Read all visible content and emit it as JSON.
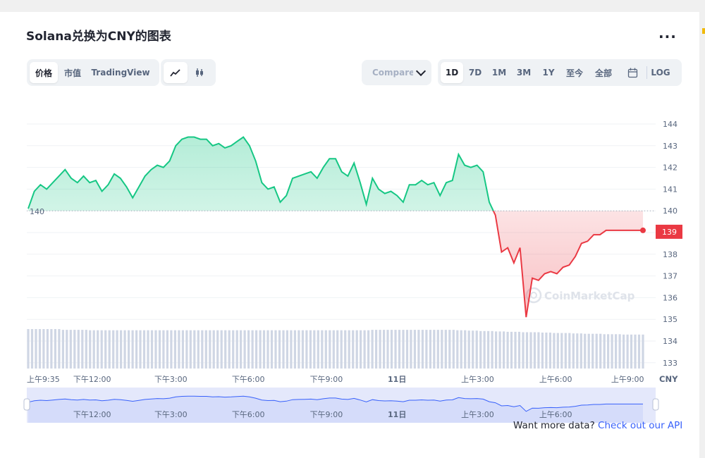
{
  "header": {
    "title": "Solana兑换为CNY的图表",
    "menu": "..."
  },
  "view_tabs": [
    {
      "label": "价格",
      "active": true
    },
    {
      "label": "市值",
      "active": false
    },
    {
      "label": "TradingView",
      "active": false
    }
  ],
  "chart_type_buttons": [
    {
      "icon": "line-chart-icon",
      "active": true
    },
    {
      "icon": "candlestick-icon",
      "active": false
    }
  ],
  "compare": {
    "placeholder": "Compare with"
  },
  "range_tabs": [
    {
      "label": "1D",
      "active": true
    },
    {
      "label": "7D",
      "active": false
    },
    {
      "label": "1M",
      "active": false
    },
    {
      "label": "3M",
      "active": false
    },
    {
      "label": "1Y",
      "active": false
    },
    {
      "label": "至今",
      "active": false
    },
    {
      "label": "全部",
      "active": false
    }
  ],
  "calendar_icon": "calendar-icon",
  "log_label": "LOG",
  "colors": {
    "up": "#16c784",
    "down": "#ea3943",
    "accent": "#3861fb",
    "volume": "#cfd6e4"
  },
  "watermark": "CoinMarketCap",
  "chart_data": {
    "type": "line",
    "baseline": 140,
    "baseline_label": "140",
    "current_label": "139",
    "currency": "CNY",
    "ylim": [
      132.6,
      144.6
    ],
    "y_ticks": [
      "144",
      "143",
      "142",
      "141",
      "140",
      "139",
      "138",
      "137",
      "136",
      "135",
      "134",
      "133"
    ],
    "x_ticks": [
      "上午9:35",
      "下午12:00",
      "下午3:00",
      "下午6:00",
      "下午9:00",
      "11日",
      "上午3:00",
      "上午6:00",
      "上午9:00"
    ],
    "x_range": [
      0,
      1
    ],
    "x_tick_positions": [
      0.0,
      0.104,
      0.232,
      0.358,
      0.485,
      0.6,
      0.731,
      0.858,
      0.975
    ],
    "series": [
      {
        "x": [
          0.0,
          0.01,
          0.02,
          0.03,
          0.04,
          0.05,
          0.06,
          0.07,
          0.08,
          0.09,
          0.1,
          0.11,
          0.12,
          0.13,
          0.14,
          0.15,
          0.16,
          0.17,
          0.18,
          0.19,
          0.2,
          0.21,
          0.22,
          0.23,
          0.24,
          0.25,
          0.26,
          0.27,
          0.28,
          0.29,
          0.3,
          0.31,
          0.32,
          0.33,
          0.34,
          0.35,
          0.36,
          0.37,
          0.38,
          0.39,
          0.4,
          0.41,
          0.42,
          0.43,
          0.44,
          0.45,
          0.46,
          0.47,
          0.48,
          0.49,
          0.5,
          0.51,
          0.52,
          0.53,
          0.54,
          0.55,
          0.56,
          0.57,
          0.58,
          0.59,
          0.6,
          0.61,
          0.62,
          0.63,
          0.64,
          0.65,
          0.66,
          0.67,
          0.68,
          0.69,
          0.7,
          0.71,
          0.72,
          0.73,
          0.74,
          0.75,
          0.76,
          0.77,
          0.78,
          0.79,
          0.8,
          0.81,
          0.82,
          0.83,
          0.84,
          0.85,
          0.86,
          0.87,
          0.88,
          0.89,
          0.9,
          0.91,
          0.92,
          0.93,
          0.94,
          0.95,
          0.96,
          0.97,
          0.98,
          0.99,
          1.0
        ],
        "y": [
          140.1,
          140.9,
          141.2,
          141.0,
          141.3,
          141.6,
          141.9,
          141.5,
          141.3,
          141.6,
          141.3,
          141.4,
          140.9,
          141.2,
          141.7,
          141.5,
          141.1,
          140.6,
          141.1,
          141.6,
          141.9,
          142.1,
          142.0,
          142.3,
          143.0,
          143.3,
          143.4,
          143.4,
          143.3,
          143.3,
          143.0,
          143.1,
          142.9,
          143.0,
          143.2,
          143.4,
          143.0,
          142.3,
          141.3,
          141.0,
          141.1,
          140.4,
          140.7,
          141.5,
          141.6,
          141.7,
          141.8,
          141.5,
          142.0,
          142.4,
          142.4,
          141.8,
          141.6,
          142.2,
          141.3,
          140.3,
          141.5,
          141.0,
          140.8,
          140.9,
          140.7,
          140.4,
          141.2,
          141.2,
          141.4,
          141.2,
          141.3,
          140.7,
          141.3,
          141.4,
          142.6,
          142.1,
          142.0,
          142.1,
          141.8,
          140.4,
          139.8,
          138.1,
          138.3,
          137.6,
          138.3,
          135.1,
          136.9,
          136.8,
          137.1,
          137.2,
          137.1,
          137.4,
          137.5,
          137.9,
          138.5,
          138.6,
          138.9,
          138.9,
          139.1,
          139.1,
          139.1,
          139.1,
          139.1,
          139.1,
          139.1
        ],
        "volume": [
          1,
          1,
          1,
          1,
          1,
          1,
          0.98,
          0.98,
          0.98,
          0.98,
          0.97,
          0.97,
          0.97,
          0.97,
          0.97,
          0.97,
          0.97,
          0.97,
          0.97,
          0.97,
          0.97,
          0.97,
          0.97,
          0.97,
          0.97,
          0.97,
          0.97,
          0.97,
          0.97,
          0.97,
          0.97,
          0.97,
          0.97,
          0.97,
          0.97,
          0.97,
          0.97,
          0.97,
          0.97,
          0.97,
          0.97,
          0.97,
          0.97,
          0.97,
          0.97,
          0.97,
          0.97,
          0.97,
          0.97,
          0.97,
          0.97,
          0.97,
          0.97,
          0.97,
          0.97,
          0.97,
          0.98,
          0.98,
          0.98,
          0.98,
          0.98,
          0.98,
          0.98,
          0.98,
          0.98,
          0.98,
          0.98,
          0.98,
          0.98,
          0.98,
          0.97,
          0.97,
          0.96,
          0.96,
          0.95,
          0.95,
          0.94,
          0.94,
          0.93,
          0.93,
          0.93,
          0.92,
          0.92,
          0.92,
          0.91,
          0.91,
          0.9,
          0.9,
          0.9,
          0.89,
          0.89,
          0.88,
          0.88,
          0.88,
          0.87,
          0.87,
          0.87,
          0.86,
          0.86,
          0.86,
          0.86
        ]
      }
    ],
    "navigator": {
      "x_ticks": [
        "下午12:00",
        "下午3:00",
        "下午6:00",
        "下午9:00",
        "11日",
        "上午3:00",
        "上午6:00"
      ]
    }
  },
  "footer": {
    "text": "Want more data?",
    "link": "Check out our API"
  }
}
